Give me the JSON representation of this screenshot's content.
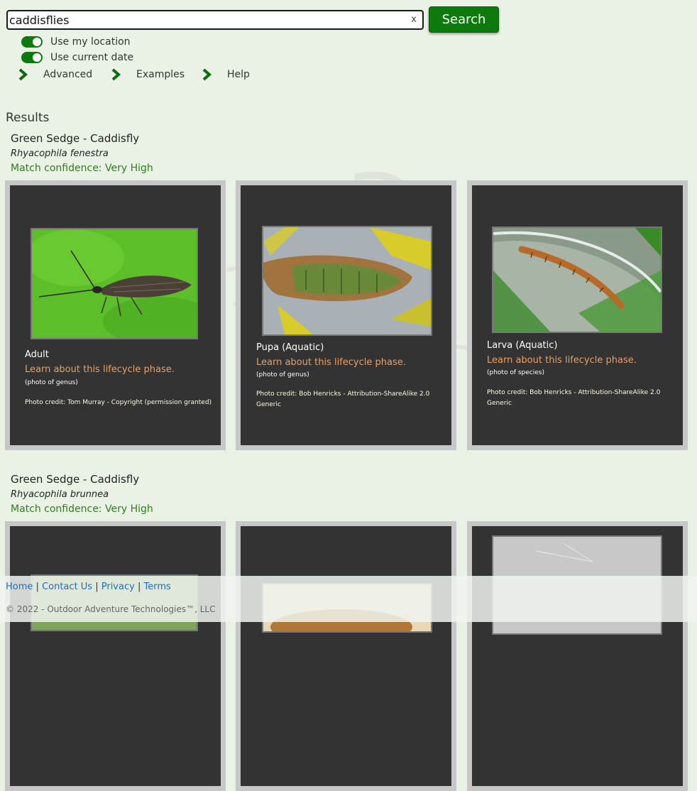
{
  "search": {
    "value": "caddisflies",
    "clear_label": "x",
    "button_label": "Search"
  },
  "toggles": [
    {
      "label": "Use my location",
      "on": true
    },
    {
      "label": "Use current date",
      "on": true
    }
  ],
  "expanders": [
    {
      "label": "Advanced"
    },
    {
      "label": "Examples"
    },
    {
      "label": "Help"
    }
  ],
  "results_title": "Results",
  "results": [
    {
      "title": "Green Sedge - Caddisfly",
      "scientific_name": "Rhyacophila fenestra",
      "confidence": "Match confidence: Very High",
      "cards": [
        {
          "phase": "Adult",
          "learn": "Learn about this lifecycle phase.",
          "note": "(photo of genus)",
          "credit": "Photo credit: Tom Murray - Copyright (permission granted)"
        },
        {
          "phase": "Pupa (Aquatic)",
          "learn": "Learn about this lifecycle phase.",
          "note": "(photo of genus)",
          "credit": "Photo credit: Bob Henricks - Attribution-ShareAlike 2.0 Generic"
        },
        {
          "phase": "Larva (Aquatic)",
          "learn": "Learn about this lifecycle phase.",
          "note": "(photo of species)",
          "credit": "Photo credit: Bob Henricks - Attribution-ShareAlike 2.0 Generic"
        }
      ]
    },
    {
      "title": "Green Sedge - Caddisfly",
      "scientific_name": "Rhyacophila brunnea",
      "confidence": "Match confidence: Very High"
    }
  ],
  "footer": {
    "links": [
      "Home",
      "Contact Us",
      "Privacy",
      "Terms"
    ],
    "copyright": "© 2022 - Outdoor Adventure Technologies™, LLC"
  },
  "colors": {
    "brand_green": "#0c7a0c",
    "confidence_green": "#2e7d1e",
    "learn_orange": "#e8a066",
    "card_bg": "#333333"
  }
}
